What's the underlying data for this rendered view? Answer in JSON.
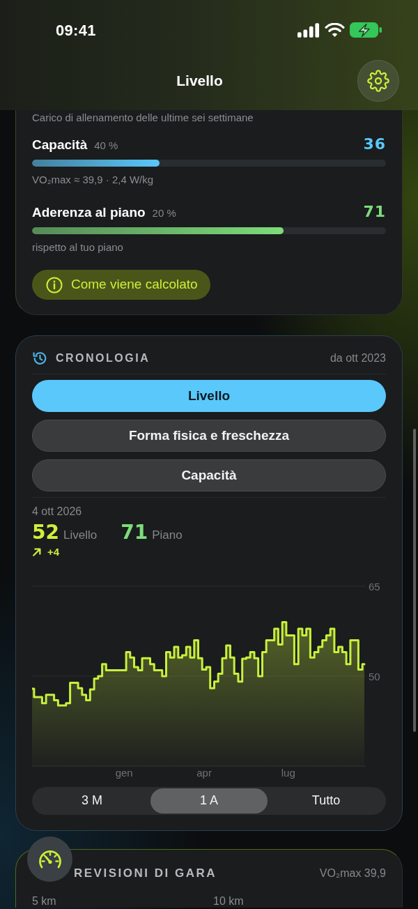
{
  "status_bar": {
    "time": "09:41"
  },
  "nav": {
    "title": "Livello"
  },
  "level_card": {
    "subtitle": "Carico di allenamento delle ultime sei settimane",
    "metrics": [
      {
        "label": "Capacità",
        "weight": "40 %",
        "value": "36",
        "level": 0.36,
        "note": "VO₂max ≈ 39,9 · 2,4 W/kg",
        "color": "#5ac8fa"
      },
      {
        "label": "Aderenza al piano",
        "weight": "20 %",
        "value": "71",
        "level": 0.71,
        "note": "rispetto al tuo piano",
        "color": "#7ddc7a"
      }
    ],
    "info_button": "Come viene calcolato"
  },
  "history": {
    "title": "CRONOLOGIA",
    "since": "da ott 2023",
    "views": [
      {
        "label": "Livello",
        "selected": true
      },
      {
        "label": "Forma fisica e freschezza",
        "selected": false
      },
      {
        "label": "Capacità",
        "selected": false
      }
    ],
    "date": "4 ott 2026",
    "readings": [
      {
        "value": "52",
        "label": "Livello",
        "color": "#cdf03a"
      },
      {
        "value": "71",
        "label": "Piano",
        "color": "#7ddc7a"
      }
    ],
    "change": "+4",
    "chart_data": {
      "type": "area",
      "categories": [
        null,
        null,
        null,
        null,
        null,
        null,
        null,
        null,
        null,
        null,
        null,
        null,
        null,
        null,
        null,
        null,
        null,
        null,
        null,
        null,
        null,
        null,
        null,
        "gen",
        null,
        null,
        null,
        null,
        null,
        null,
        null,
        null,
        null,
        null,
        null,
        null,
        null,
        null,
        null,
        null,
        null,
        null,
        null,
        "apr",
        null,
        null,
        null,
        null,
        null,
        null,
        null,
        null,
        null,
        null,
        null,
        null,
        null,
        null,
        null,
        null,
        null,
        null,
        null,
        null,
        "lug",
        null,
        null,
        null,
        null,
        null,
        null,
        null,
        null,
        null,
        null,
        null,
        null,
        null,
        null,
        null,
        null,
        null,
        null,
        null
      ],
      "ylim": [
        35,
        65
      ],
      "yticks": [
        50,
        65
      ],
      "series": [
        {
          "color": "#c8f03c",
          "values": [
            47.9,
            46.5,
            46.5,
            45.5,
            46.9,
            46.9,
            46.0,
            45.1,
            45.1,
            45.5,
            48.9,
            48.9,
            48.0,
            46.9,
            46.0,
            47.8,
            49.6,
            50.0,
            52.0,
            51.0,
            51.0,
            51.0,
            51.0,
            51.0,
            54.0,
            53.1,
            51.5,
            51.0,
            53.0,
            53.0,
            52.0,
            51.0,
            51.0,
            50.0,
            54.0,
            53.1,
            54.9,
            53.1,
            53.5,
            54.9,
            53.1,
            56.0,
            53.0,
            51.1,
            51.5,
            48.0,
            49.1,
            50.4,
            53.0,
            55.1,
            53.1,
            50.4,
            49.1,
            52.9,
            53.1,
            54.0,
            53.0,
            50.0,
            54.0,
            56.0,
            56.0,
            57.9,
            55.3,
            59.0,
            56.8,
            56.8,
            52.0,
            57.9,
            56.8,
            57.9,
            53.1,
            54.0,
            54.9,
            56.0,
            56.8,
            57.9,
            54.0,
            54.9,
            54.0,
            52.0,
            56.0,
            56.0,
            51.1,
            52.0
          ]
        }
      ]
    },
    "ranges": [
      {
        "label": "3 M",
        "selected": false
      },
      {
        "label": "1 A",
        "selected": true
      },
      {
        "label": "Tutto",
        "selected": false
      }
    ]
  },
  "race_card": {
    "title": "REVISIONI DI GARA",
    "vo2max": "VO₂max 39,9",
    "distances": [
      "5 km",
      "10 km"
    ]
  }
}
